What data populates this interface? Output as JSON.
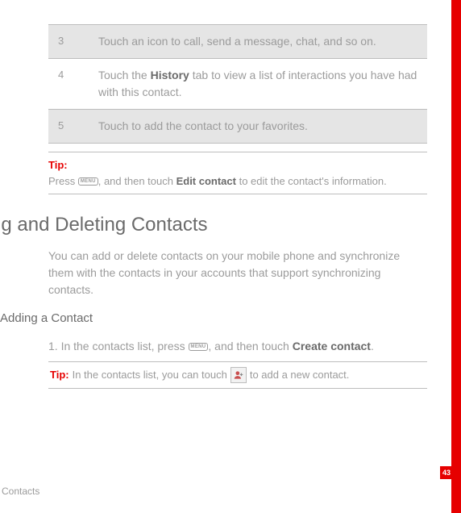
{
  "table": {
    "rows": [
      {
        "num": "3",
        "text": "Touch an icon to call, send a message, chat, and so on."
      },
      {
        "num": "4",
        "text_pre": "Touch the ",
        "bold": "History",
        "text_post": " tab to view a list of interactions you have had with this contact."
      },
      {
        "num": "5",
        "text": "Touch to add the contact to your favorites."
      }
    ]
  },
  "tip1": {
    "label": "Tip:",
    "pre": "Press ",
    "mid": ", and then touch ",
    "bold": "Edit contact",
    "post": " to edit the contact's information."
  },
  "section_title": "Adding and Deleting Contacts",
  "section_intro": "You can add or delete contacts on your mobile phone and synchronize them with the contacts in your accounts that support synchronizing contacts.",
  "subsection_title": "Adding a Contact",
  "step1": {
    "pre": "1. In the contacts list, press ",
    "mid": ", and then touch ",
    "bold": "Create contact",
    "post": "."
  },
  "tip2": {
    "label": "Tip:",
    "pre": "  In the contacts list, you can touch ",
    "post": " to add a new contact."
  },
  "menu_icon_text": "MENU",
  "page_number": "43",
  "footer": "Contacts"
}
